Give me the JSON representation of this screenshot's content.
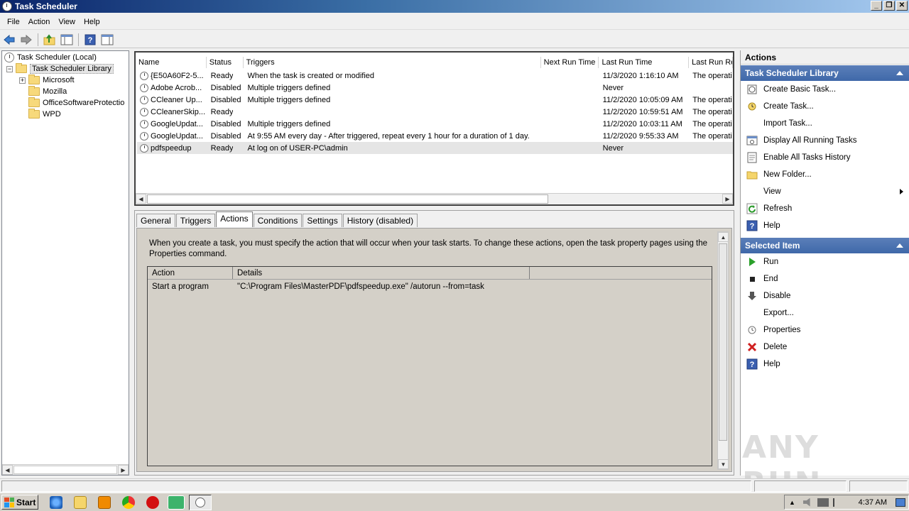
{
  "window": {
    "title": "Task Scheduler",
    "controls": [
      "_",
      "❐",
      "✕"
    ]
  },
  "menu": [
    "File",
    "Action",
    "View",
    "Help"
  ],
  "tree": {
    "root": "Task Scheduler (Local)",
    "library": "Task Scheduler Library",
    "children": [
      "Microsoft",
      "Mozilla",
      "OfficeSoftwareProtectio",
      "WPD"
    ]
  },
  "tasklist": {
    "columns": [
      "Name",
      "Status",
      "Triggers",
      "Next Run Time",
      "Last Run Time",
      "Last Run Re"
    ],
    "rows": [
      {
        "name": "{E50A60F2-5...",
        "status": "Ready",
        "triggers": "When the task is created or modified",
        "next": "",
        "last": "11/3/2020 1:16:10 AM",
        "result": "The operati"
      },
      {
        "name": "Adobe Acrob...",
        "status": "Disabled",
        "triggers": "Multiple triggers defined",
        "next": "",
        "last": "Never",
        "result": ""
      },
      {
        "name": "CCleaner Up...",
        "status": "Disabled",
        "triggers": "Multiple triggers defined",
        "next": "",
        "last": "11/2/2020 10:05:09 AM",
        "result": "The operati"
      },
      {
        "name": "CCleanerSkip...",
        "status": "Ready",
        "triggers": "",
        "next": "",
        "last": "11/2/2020 10:59:51 AM",
        "result": "The operati"
      },
      {
        "name": "GoogleUpdat...",
        "status": "Disabled",
        "triggers": "Multiple triggers defined",
        "next": "",
        "last": "11/2/2020 10:03:11 AM",
        "result": "The operati"
      },
      {
        "name": "GoogleUpdat...",
        "status": "Disabled",
        "triggers": "At 9:55 AM every day - After triggered, repeat every 1 hour for a duration of 1 day.",
        "next": "",
        "last": "11/2/2020 9:55:33 AM",
        "result": "The operati"
      },
      {
        "name": "pdfspeedup",
        "status": "Ready",
        "triggers": "At log on of USER-PC\\admin",
        "next": "",
        "last": "Never",
        "result": ""
      }
    ]
  },
  "detail": {
    "tabs": [
      "General",
      "Triggers",
      "Actions",
      "Conditions",
      "Settings",
      "History (disabled)"
    ],
    "active_tab": "Actions",
    "description": "When you create a task, you must specify the action that will occur when your task starts.  To change these actions, open the task property pages using the Properties command.",
    "columns": [
      "Action",
      "Details"
    ],
    "rows": [
      {
        "action": "Start a program",
        "details": "\"C:\\Program Files\\MasterPDF\\pdfspeedup.exe\" /autorun --from=task"
      }
    ]
  },
  "actions_pane": {
    "title": "Actions",
    "library_section": "Task Scheduler Library",
    "library_items": [
      {
        "label": "Create Basic Task...",
        "icon": "create-basic-task-icon"
      },
      {
        "label": "Create Task...",
        "icon": "create-task-icon"
      },
      {
        "label": "Import Task...",
        "icon": ""
      },
      {
        "label": "Display All Running Tasks",
        "icon": "running-tasks-icon"
      },
      {
        "label": "Enable All Tasks History",
        "icon": "history-icon"
      },
      {
        "label": "New Folder...",
        "icon": "folder-icon"
      },
      {
        "label": "View",
        "icon": ""
      },
      {
        "label": "Refresh",
        "icon": "refresh-icon"
      },
      {
        "label": "Help",
        "icon": "help-icon"
      }
    ],
    "selected_section": "Selected Item",
    "selected_items": [
      {
        "label": "Run",
        "icon": "run-icon"
      },
      {
        "label": "End",
        "icon": "end-icon"
      },
      {
        "label": "Disable",
        "icon": "disable-icon"
      },
      {
        "label": "Export...",
        "icon": ""
      },
      {
        "label": "Properties",
        "icon": "properties-icon"
      },
      {
        "label": "Delete",
        "icon": "delete-icon"
      },
      {
        "label": "Help",
        "icon": "help-icon"
      }
    ]
  },
  "taskbar": {
    "start": "Start",
    "time": "4:37 AM"
  },
  "watermark": "ANY RUN",
  "colors": {
    "section_header": "#4a70b0",
    "title_bar": "#0a246a"
  }
}
